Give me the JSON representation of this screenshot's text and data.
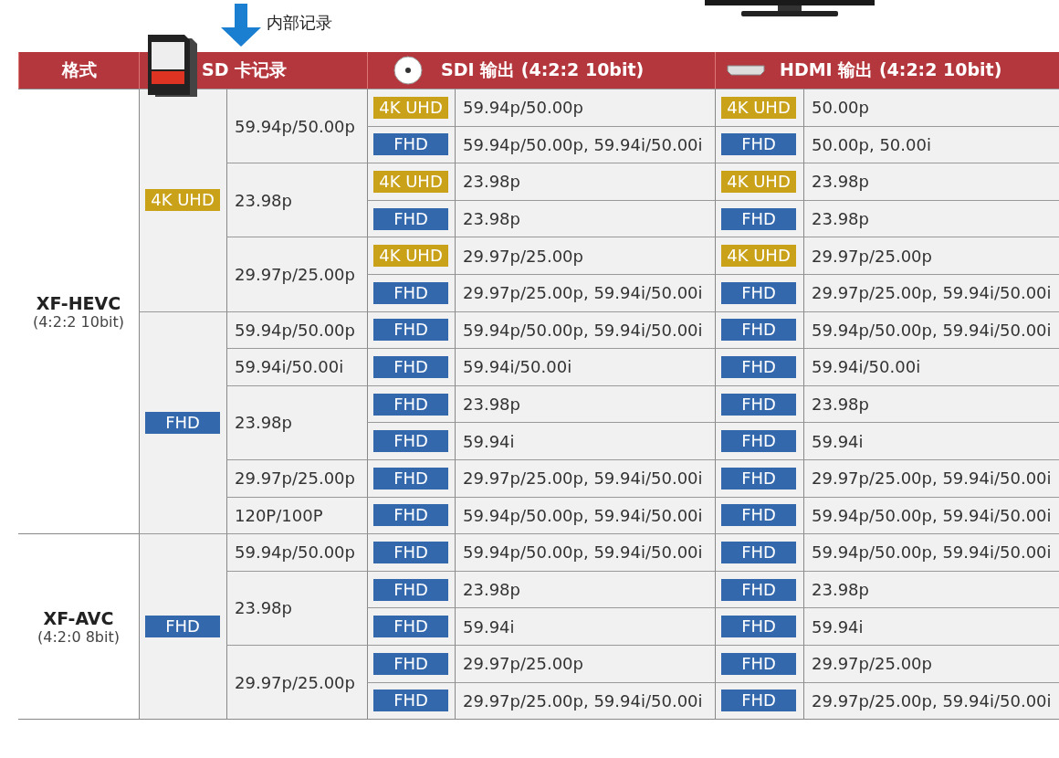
{
  "top": {
    "caption": "内部记录"
  },
  "header": {
    "format": "格式",
    "sd": "SD 卡记录",
    "sdi": "SDI 输出 (4:2:2 10bit)",
    "hdmi": "HDMI 输出 (4:2:2 10bit)"
  },
  "formats": [
    {
      "name": "XF-HEVC",
      "spec": "(4:2:2 10bit)",
      "resolutions": [
        {
          "kind": "uhd",
          "label": "4K UHD",
          "rates": [
            {
              "rate": "59.94p/50.00p",
              "outputs": [
                {
                  "sdi": {
                    "kind": "uhd",
                    "tag": "4K UHD",
                    "text": "59.94p/50.00p"
                  },
                  "hdmi": {
                    "kind": "uhd",
                    "tag": "4K UHD",
                    "text": "50.00p"
                  }
                },
                {
                  "sdi": {
                    "kind": "fhd",
                    "tag": "FHD",
                    "text": "59.94p/50.00p, 59.94i/50.00i"
                  },
                  "hdmi": {
                    "kind": "fhd",
                    "tag": "FHD",
                    "text": "50.00p, 50.00i"
                  }
                }
              ]
            },
            {
              "rate": "23.98p",
              "outputs": [
                {
                  "sdi": {
                    "kind": "uhd",
                    "tag": "4K UHD",
                    "text": "23.98p"
                  },
                  "hdmi": {
                    "kind": "uhd",
                    "tag": "4K UHD",
                    "text": "23.98p"
                  }
                },
                {
                  "sdi": {
                    "kind": "fhd",
                    "tag": "FHD",
                    "text": "23.98p"
                  },
                  "hdmi": {
                    "kind": "fhd",
                    "tag": "FHD",
                    "text": "23.98p"
                  }
                }
              ]
            },
            {
              "rate": "29.97p/25.00p",
              "outputs": [
                {
                  "sdi": {
                    "kind": "uhd",
                    "tag": "4K UHD",
                    "text": "29.97p/25.00p"
                  },
                  "hdmi": {
                    "kind": "uhd",
                    "tag": "4K UHD",
                    "text": "29.97p/25.00p"
                  }
                },
                {
                  "sdi": {
                    "kind": "fhd",
                    "tag": "FHD",
                    "text": "29.97p/25.00p, 59.94i/50.00i"
                  },
                  "hdmi": {
                    "kind": "fhd",
                    "tag": "FHD",
                    "text": "29.97p/25.00p, 59.94i/50.00i"
                  }
                }
              ]
            }
          ]
        },
        {
          "kind": "fhd",
          "label": "FHD",
          "rates": [
            {
              "rate": "59.94p/50.00p",
              "outputs": [
                {
                  "sdi": {
                    "kind": "fhd",
                    "tag": "FHD",
                    "text": "59.94p/50.00p, 59.94i/50.00i"
                  },
                  "hdmi": {
                    "kind": "fhd",
                    "tag": "FHD",
                    "text": "59.94p/50.00p, 59.94i/50.00i"
                  }
                }
              ]
            },
            {
              "rate": "59.94i/50.00i",
              "outputs": [
                {
                  "sdi": {
                    "kind": "fhd",
                    "tag": "FHD",
                    "text": "59.94i/50.00i"
                  },
                  "hdmi": {
                    "kind": "fhd",
                    "tag": "FHD",
                    "text": "59.94i/50.00i"
                  }
                }
              ]
            },
            {
              "rate": "23.98p",
              "outputs": [
                {
                  "sdi": {
                    "kind": "fhd",
                    "tag": "FHD",
                    "text": "23.98p"
                  },
                  "hdmi": {
                    "kind": "fhd",
                    "tag": "FHD",
                    "text": "23.98p"
                  }
                },
                {
                  "sdi": {
                    "kind": "fhd",
                    "tag": "FHD",
                    "text": "59.94i"
                  },
                  "hdmi": {
                    "kind": "fhd",
                    "tag": "FHD",
                    "text": "59.94i"
                  }
                }
              ]
            },
            {
              "rate": "29.97p/25.00p",
              "outputs": [
                {
                  "sdi": {
                    "kind": "fhd",
                    "tag": "FHD",
                    "text": "29.97p/25.00p, 59.94i/50.00i"
                  },
                  "hdmi": {
                    "kind": "fhd",
                    "tag": "FHD",
                    "text": "29.97p/25.00p, 59.94i/50.00i"
                  }
                }
              ]
            },
            {
              "rate": "120P/100P",
              "outputs": [
                {
                  "sdi": {
                    "kind": "fhd",
                    "tag": "FHD",
                    "text": "59.94p/50.00p, 59.94i/50.00i"
                  },
                  "hdmi": {
                    "kind": "fhd",
                    "tag": "FHD",
                    "text": "59.94p/50.00p, 59.94i/50.00i"
                  }
                }
              ]
            }
          ]
        }
      ]
    },
    {
      "name": "XF-AVC",
      "spec": "(4:2:0 8bit)",
      "resolutions": [
        {
          "kind": "fhd",
          "label": "FHD",
          "rates": [
            {
              "rate": "59.94p/50.00p",
              "outputs": [
                {
                  "sdi": {
                    "kind": "fhd",
                    "tag": "FHD",
                    "text": "59.94p/50.00p, 59.94i/50.00i"
                  },
                  "hdmi": {
                    "kind": "fhd",
                    "tag": "FHD",
                    "text": "59.94p/50.00p, 59.94i/50.00i"
                  }
                }
              ]
            },
            {
              "rate": "23.98p",
              "outputs": [
                {
                  "sdi": {
                    "kind": "fhd",
                    "tag": "FHD",
                    "text": "23.98p"
                  },
                  "hdmi": {
                    "kind": "fhd",
                    "tag": "FHD",
                    "text": "23.98p"
                  }
                },
                {
                  "sdi": {
                    "kind": "fhd",
                    "tag": "FHD",
                    "text": "59.94i"
                  },
                  "hdmi": {
                    "kind": "fhd",
                    "tag": "FHD",
                    "text": "59.94i"
                  }
                }
              ]
            },
            {
              "rate": "29.97p/25.00p",
              "outputs": [
                {
                  "sdi": {
                    "kind": "fhd",
                    "tag": "FHD",
                    "text": "29.97p/25.00p"
                  },
                  "hdmi": {
                    "kind": "fhd",
                    "tag": "FHD",
                    "text": "29.97p/25.00p"
                  }
                },
                {
                  "sdi": {
                    "kind": "fhd",
                    "tag": "FHD",
                    "text": "29.97p/25.00p, 59.94i/50.00i"
                  },
                  "hdmi": {
                    "kind": "fhd",
                    "tag": "FHD",
                    "text": "29.97p/25.00p, 59.94i/50.00i"
                  }
                }
              ]
            }
          ]
        }
      ]
    }
  ]
}
